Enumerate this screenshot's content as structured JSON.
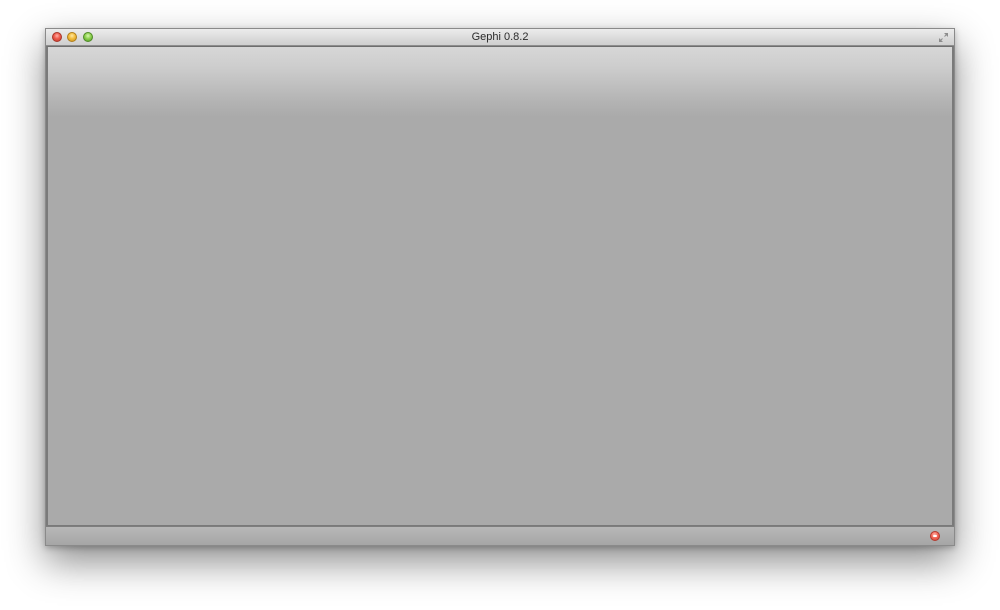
{
  "window": {
    "title": "Gephi 0.8.2"
  },
  "titlebar": {
    "buttons": [
      {
        "name": "close",
        "color": "#ee5a4c"
      },
      {
        "name": "minimize",
        "color": "#f3bd3d"
      },
      {
        "name": "zoom",
        "color": "#8ed14f"
      }
    ],
    "fullscreen_icon": "fullscreen-arrows-icon"
  },
  "statusbar": {
    "icon": "error-indicator-icon",
    "icon_color": "#f26a5b"
  }
}
